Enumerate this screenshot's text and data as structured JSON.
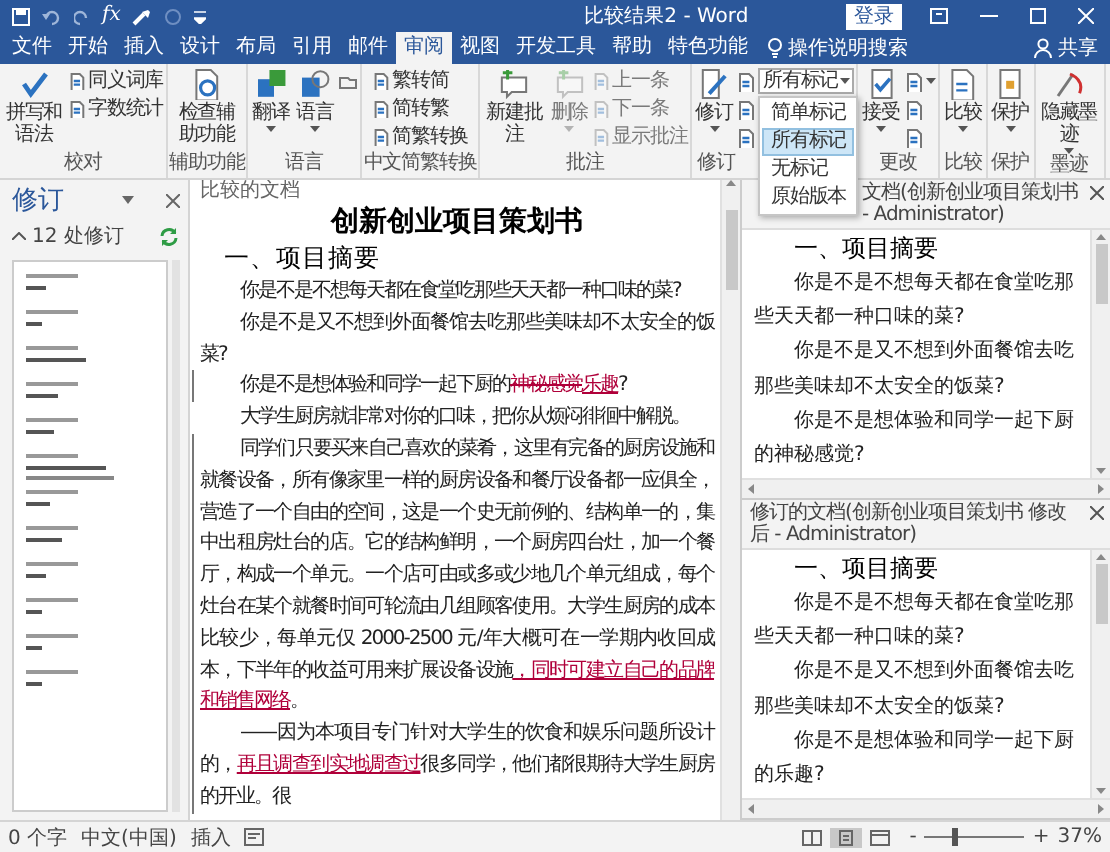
{
  "window": {
    "title": "比较结果2 - Word",
    "formula_button": "fx",
    "login": "登录"
  },
  "tabs": [
    {
      "label": "文件",
      "selected": false
    },
    {
      "label": "开始",
      "selected": false
    },
    {
      "label": "插入",
      "selected": false
    },
    {
      "label": "设计",
      "selected": false
    },
    {
      "label": "布局",
      "selected": false
    },
    {
      "label": "引用",
      "selected": false
    },
    {
      "label": "邮件",
      "selected": false
    },
    {
      "label": "审阅",
      "selected": true
    },
    {
      "label": "视图",
      "selected": false
    },
    {
      "label": "开发工具",
      "selected": false
    },
    {
      "label": "帮助",
      "selected": false
    },
    {
      "label": "特色功能",
      "selected": false
    }
  ],
  "tell_me": "操作说明搜索",
  "share": "共享",
  "ribbon": {
    "groups": [
      {
        "label": "校对",
        "buttons": [
          {
            "kind": "large",
            "label": "拼写和语法",
            "disabled": false,
            "menu": false
          },
          {
            "kind": "small",
            "label": "同义词库",
            "disabled": false
          },
          {
            "kind": "small",
            "label": "字数统计",
            "disabled": false
          }
        ]
      },
      {
        "label": "辅助功能",
        "buttons": [
          {
            "kind": "large",
            "label": "检查辅助功能",
            "disabled": false,
            "menu": false
          }
        ]
      },
      {
        "label": "语言",
        "buttons": [
          {
            "kind": "large",
            "label": "翻译",
            "disabled": false,
            "menu": true
          },
          {
            "kind": "large",
            "label": "语言",
            "disabled": false,
            "menu": true
          },
          {
            "kind": "icon",
            "disabled": false,
            "menu": false
          }
        ]
      },
      {
        "label": "中文简繁转换",
        "buttons": [
          {
            "kind": "small",
            "label": "繁转简",
            "disabled": false
          },
          {
            "kind": "small",
            "label": "简转繁",
            "disabled": false
          },
          {
            "kind": "small",
            "label": "简繁转换",
            "disabled": false
          }
        ]
      },
      {
        "label": "批注",
        "buttons": [
          {
            "kind": "large",
            "label": "新建批注",
            "disabled": false,
            "menu": false
          },
          {
            "kind": "large",
            "label": "删除",
            "disabled": true,
            "menu": true
          },
          {
            "kind": "small",
            "label": "上一条",
            "disabled": true
          },
          {
            "kind": "small",
            "label": "下一条",
            "disabled": true
          },
          {
            "kind": "small",
            "label": "显示批注",
            "disabled": true
          }
        ]
      },
      {
        "label": "修订",
        "buttons": [
          {
            "kind": "large",
            "label": "修订",
            "disabled": false,
            "menu": true
          },
          {
            "kind": "icon",
            "disabled": false,
            "menu": false
          },
          {
            "kind": "icon",
            "disabled": false,
            "menu": false
          },
          {
            "kind": "icon",
            "disabled": false,
            "menu": false
          },
          {
            "kind": "select",
            "value": "所有标记",
            "options": [
              {
                "label": "简单标记",
                "selected": false
              },
              {
                "label": "所有标记",
                "selected": true
              },
              {
                "label": "无标记",
                "selected": false
              },
              {
                "label": "原始版本",
                "selected": false
              }
            ]
          }
        ]
      },
      {
        "label": "更改",
        "buttons": [
          {
            "kind": "large",
            "label": "接受",
            "disabled": false,
            "menu": true
          },
          {
            "kind": "icon",
            "disabled": false,
            "menu": true
          },
          {
            "kind": "icon",
            "disabled": false,
            "menu": false
          },
          {
            "kind": "icon",
            "disabled": false,
            "menu": false
          }
        ]
      },
      {
        "label": "比较",
        "buttons": [
          {
            "kind": "large",
            "label": "比较",
            "disabled": false,
            "menu": true
          }
        ]
      },
      {
        "label": "保护",
        "buttons": [
          {
            "kind": "large",
            "label": "保护",
            "disabled": false,
            "menu": true
          }
        ]
      },
      {
        "label": "墨迹",
        "buttons": [
          {
            "kind": "large",
            "label": "隐藏墨迹",
            "disabled": false,
            "menu": true
          }
        ]
      }
    ]
  },
  "revisions_pane": {
    "title": "修订",
    "count": "12 处修订"
  },
  "document": {
    "header": "比较的文档",
    "title": "创新创业项目策划书",
    "heading": "一、项目摘要",
    "paragraphs": [
      {
        "segments": [
          {
            "kind": "plain",
            "text": "你是不是不想每天都在食堂吃那些天天都一种口味的菜?"
          }
        ]
      },
      {
        "segments": [
          {
            "kind": "plain",
            "text": "你是不是又不想到外面餐馆去吃那些美味却不太安全的饭菜?"
          }
        ]
      },
      {
        "segments": [
          {
            "kind": "plain",
            "text": "你是不是想体验和同学一起下厨的"
          },
          {
            "kind": "delete",
            "text": "神秘感觉"
          },
          {
            "kind": "insert",
            "text": "乐趣"
          },
          {
            "kind": "plain",
            "text": "?"
          }
        ]
      },
      {
        "segments": [
          {
            "kind": "plain",
            "text": "大学生厨房就非常对你的口味，把你从烦闷徘徊中解脱。"
          }
        ]
      },
      {
        "segments": [
          {
            "kind": "plain",
            "text": "同学们只要买来自己喜欢的菜肴，这里有完备的厨房设施和就餐设备，所有像家里一样的厨房设备和餐厅设备都一应俱全，营造了一个自由的空间，这是一个史无前例的、结构单一的，集中出租房灶台的店。它的结构鲜明，一个厨房四台灶，加一个餐厅，构成一个单元。一个店可由或多或少地几个单元组成，每个灶台在某个就餐时间可轮流由几组顾客使用。大学生厨房的成本比较少，每单元仅 2000-2500 元/年大概可在一学期内收回成本，下半年的收益可用来扩展设备设施"
          },
          {
            "kind": "insert",
            "text": "，同时可建立自己的品牌和销售网络"
          },
          {
            "kind": "plain",
            "text": "。"
          }
        ]
      },
      {
        "segments": [
          {
            "kind": "plain",
            "text": "——因为本项目专门针对大学生的饮食和娱乐问题所设计的，"
          },
          {
            "kind": "insert",
            "text": "再且调查到实地调查过"
          },
          {
            "kind": "plain",
            "text": "很多同学，他们都很期待大学生厨房的开业。很"
          }
        ]
      }
    ]
  },
  "compare_panes": [
    {
      "title": "文档(创新创业项目策划书 - Administrator)",
      "heading": "一、项目摘要",
      "paragraphs": [
        "你是不是不想每天都在食堂吃那些天天都一种口味的菜?",
        "你是不是又不想到外面餐馆去吃那些美味却不太安全的饭菜?",
        "你是不是想体验和同学一起下厨的神秘感觉?"
      ]
    },
    {
      "title": "修订的文档(创新创业项目策划书 修改后 - Administrator)",
      "heading": "一、项目摘要",
      "paragraphs": [
        "你是不是不想每天都在食堂吃那些天天都一种口味的菜?",
        "你是不是又不想到外面餐馆去吃那些美味却不太安全的饭菜?",
        "你是不是想体验和同学一起下厨的乐趣?"
      ]
    }
  ],
  "status_bar": {
    "words": "0 个字",
    "language": "中文(中国)",
    "mode": "插入",
    "views": [
      {
        "selected": false
      },
      {
        "selected": true
      },
      {
        "selected": false
      }
    ],
    "zoom_out": "-",
    "zoom": {
      "level": 0.3
    },
    "zoom_in": "+",
    "zoom_text": "37%"
  }
}
